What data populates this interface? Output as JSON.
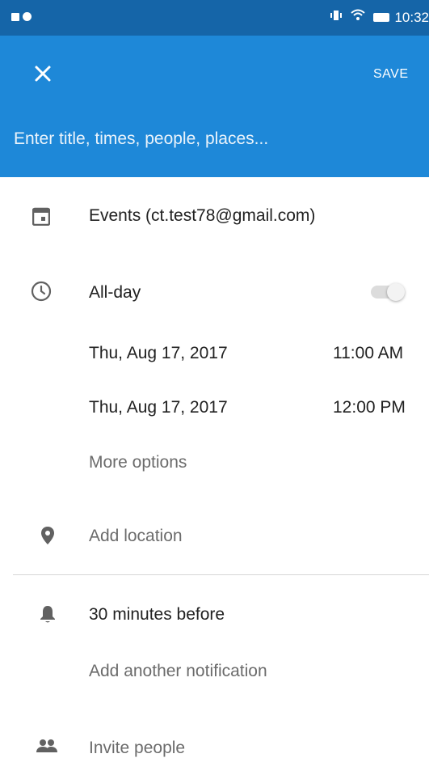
{
  "status_bar": {
    "time": "10:32",
    "icons": [
      "notification-icon",
      "sync-icon",
      "vibrate-icon",
      "wifi-icon",
      "battery-icon"
    ]
  },
  "app_bar": {
    "close_icon": "close-icon",
    "save_label": "SAVE",
    "title_placeholder": "Enter title, times, people, places..."
  },
  "calendar": {
    "icon": "calendar-icon",
    "label": "Events (ct.test78@gmail.com)"
  },
  "time": {
    "icon": "clock-icon",
    "all_day_label": "All-day",
    "all_day_on": false,
    "start_date": "Thu, Aug 17, 2017",
    "start_time": "11:00 AM",
    "end_date": "Thu, Aug 17, 2017",
    "end_time": "12:00 PM",
    "more_options": "More options"
  },
  "location": {
    "icon": "location-pin-icon",
    "placeholder": "Add location"
  },
  "notification": {
    "icon": "bell-icon",
    "current": "30 minutes before",
    "add_another": "Add another notification"
  },
  "people": {
    "icon": "people-icon",
    "label": "Invite people"
  },
  "colors": {
    "primary": "#1e88d8",
    "status_bar": "#1565a8",
    "icon_gray": "#616161",
    "muted_text": "#6b6b6b"
  }
}
